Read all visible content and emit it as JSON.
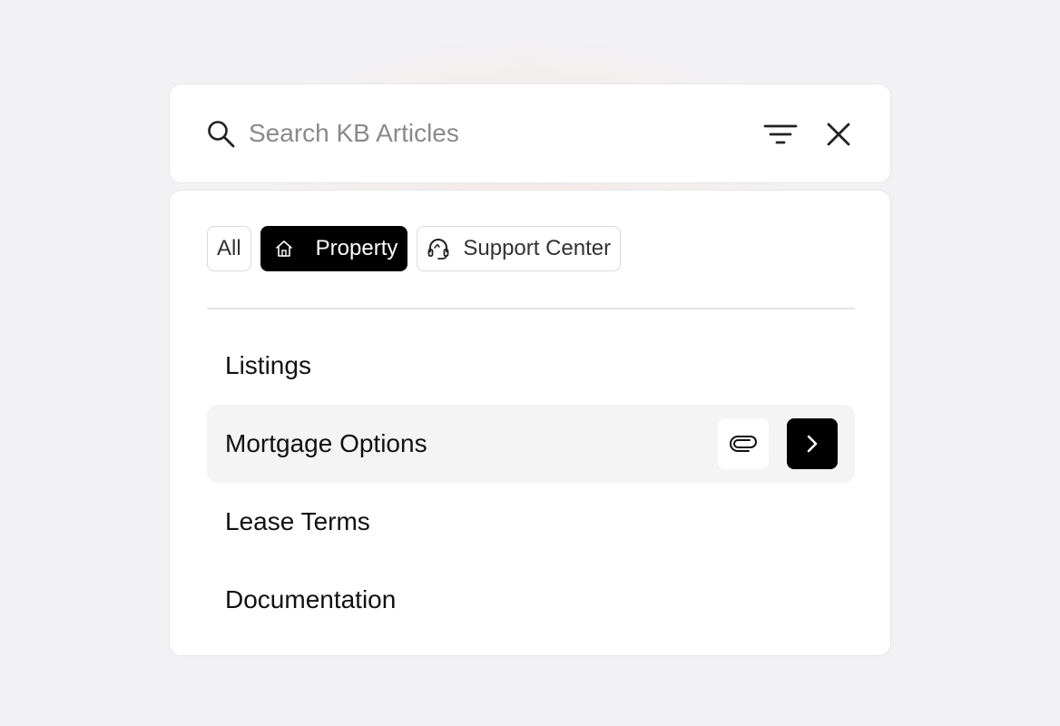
{
  "search": {
    "placeholder": "Search KB Articles",
    "value": "",
    "icons": {
      "search": "search-icon",
      "filter": "filter-icon",
      "close": "close-icon"
    }
  },
  "filters": {
    "chips": [
      {
        "label": "All",
        "icon": null,
        "active": false
      },
      {
        "label": "Property",
        "icon": "home-icon",
        "active": true
      },
      {
        "label": "Support Center",
        "icon": "headset-icon",
        "active": false
      }
    ]
  },
  "results": {
    "items": [
      {
        "label": "Listings",
        "highlighted": false
      },
      {
        "label": "Mortgage Options",
        "highlighted": true,
        "actions": [
          "paperclip-icon",
          "chevron-right-icon"
        ]
      },
      {
        "label": "Lease Terms",
        "highlighted": false
      },
      {
        "label": "Documentation",
        "highlighted": false
      }
    ]
  },
  "colors": {
    "page_background": "#f2f2f4",
    "card_background": "#ffffff",
    "active_chip": "#000000",
    "highlight_row": "#f4f4f5",
    "placeholder_text": "#8a8a8e"
  }
}
